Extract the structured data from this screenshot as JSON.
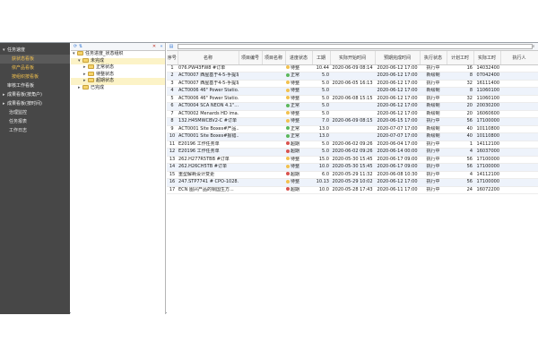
{
  "nav": {
    "groups": [
      {
        "label": "任务速度",
        "children": [
          "获状态看板",
          "依产品看板",
          "按组织按看板"
        ]
      },
      {
        "label": "审核工作看板",
        "children": []
      },
      {
        "label": "成果看板(按角户)",
        "children": []
      },
      {
        "label": "成果看板(按时间)",
        "children": []
      }
    ],
    "plain": [
      "治理监控",
      "任务报表",
      "工作日志"
    ]
  },
  "tree": {
    "root": "任务进度_状态组织",
    "nodes": [
      {
        "label": "未完成",
        "level": 1,
        "expanded": true,
        "selected": true
      },
      {
        "label": "正常状态",
        "level": 2
      },
      {
        "label": "待整状态",
        "level": 2
      },
      {
        "label": "超期状态",
        "level": 2
      },
      {
        "label": "已完成",
        "level": 1
      }
    ]
  },
  "grid": {
    "columns": [
      "序号",
      "名称",
      "项目编号",
      "项目名称",
      "进度状态",
      "工期",
      "实际开始时间",
      "预期完成时间",
      "执行状态",
      "计划工时",
      "实际工时",
      "执行人"
    ],
    "rows": [
      {
        "no": "1",
        "name": "076.PW43FW8 #订单",
        "status": "待整",
        "status_color": "#f2c14e",
        "dur": "10.44",
        "start": "2020-06-09 08:14",
        "due": "2020-06-12 17:00",
        "exec": "执行中",
        "plan": "16",
        "actual": "14032400"
      },
      {
        "no": "2",
        "name": "ACT0007 西屋基于4-5-手提车...",
        "status": "正常",
        "status_color": "#5cb85c",
        "dur": "5.0",
        "start": "",
        "due": "2020-06-12 17:00",
        "exec": "新绘制",
        "plan": "8",
        "actual": "07042400"
      },
      {
        "no": "3",
        "name": "ACT0007 西屋基于4-5-手提车...",
        "status": "待整",
        "status_color": "#f2c14e",
        "dur": "5.0",
        "start": "2020-06-05 16:13",
        "due": "2020-06-12 17:00",
        "exec": "执行中",
        "plan": "32",
        "actual": "16111400"
      },
      {
        "no": "4",
        "name": "ACT0006 46\" Power Statio...",
        "status": "待整",
        "status_color": "#f2c14e",
        "dur": "5.0",
        "start": "",
        "due": "2020-06-12 17:00",
        "exec": "新绘制",
        "plan": "8",
        "actual": "11060100"
      },
      {
        "no": "5",
        "name": "ACT0006 46\" Power Statio...",
        "status": "待整",
        "status_color": "#f2c14e",
        "dur": "5.0",
        "start": "2020-06-08 15:15",
        "due": "2020-06-12 17:00",
        "exec": "执行中",
        "plan": "32",
        "actual": "11060100"
      },
      {
        "no": "6",
        "name": "ACT0004 SCA NEON 4.1\"...",
        "status": "正常",
        "status_color": "#5cb85c",
        "dur": "5.0",
        "start": "",
        "due": "2020-06-12 17:00",
        "exec": "新绘制",
        "plan": "20",
        "actual": "20030200"
      },
      {
        "no": "7",
        "name": "ACT0002 Menards HD ima...",
        "status": "待整",
        "status_color": "#f2c14e",
        "dur": "5.0",
        "start": "",
        "due": "2020-06-12 17:00",
        "exec": "新绘制",
        "plan": "20",
        "actual": "16060600"
      },
      {
        "no": "8",
        "name": "132.H45MWCBV2-C #订单",
        "status": "待整",
        "status_color": "#f2c14e",
        "dur": "7.0",
        "start": "2020-06-09 08:15",
        "due": "2020-06-15 17:00",
        "exec": "执行中",
        "plan": "56",
        "actual": "17100000"
      },
      {
        "no": "9",
        "name": "ACT0001 Site Boxes#产品...",
        "status": "正常",
        "status_color": "#5cb85c",
        "dur": "13.0",
        "start": "",
        "due": "2020-07-07 17:00",
        "exec": "新绘制",
        "plan": "40",
        "actual": "10110800"
      },
      {
        "no": "10",
        "name": "ACT0001 Site Boxes#报错...",
        "status": "正常",
        "status_color": "#5cb85c",
        "dur": "13.0",
        "start": "",
        "due": "2020-07-07 17:00",
        "exec": "新绘制",
        "plan": "40",
        "actual": "10110800"
      },
      {
        "no": "11",
        "name": "E20196 工作任务单",
        "status": "超期",
        "status_color": "#d9534f",
        "dur": "5.0",
        "start": "2020-06-02 09:26",
        "due": "2020-06-04 17:00",
        "exec": "执行中",
        "plan": "1",
        "actual": "14112100"
      },
      {
        "no": "12",
        "name": "E20196 工作任务单",
        "status": "超期",
        "status_color": "#d9534f",
        "dur": "5.0",
        "start": "2020-06-02 09:26",
        "due": "2020-06-14 00:00",
        "exec": "执行中",
        "plan": "4",
        "actual": "16037000"
      },
      {
        "no": "13",
        "name": "262.H277R5TBB #订单",
        "status": "待整",
        "status_color": "#f2c14e",
        "dur": "15.0",
        "start": "2020-05-30 15:45",
        "due": "2020-06-17 09:00",
        "exec": "执行中",
        "plan": "56",
        "actual": "17100000"
      },
      {
        "no": "14",
        "name": "262.H26CH5TB #订单",
        "status": "待整",
        "status_color": "#f2c14e",
        "dur": "10.0",
        "start": "2020-05-30 15:45",
        "due": "2020-06-17 09:00",
        "exec": "执行中",
        "plan": "56",
        "actual": "17100000"
      },
      {
        "no": "15",
        "name": "重型解耗设计变更",
        "status": "超期",
        "status_color": "#d9534f",
        "dur": "6.0",
        "start": "2020-05-29 11:32",
        "due": "2020-06-08 10:30",
        "exec": "执行中",
        "plan": "4",
        "actual": "14112100"
      },
      {
        "no": "16",
        "name": "247.STP7741 # CPO-1028...",
        "status": "待整",
        "status_color": "#f2c14e",
        "dur": "10.13",
        "start": "2020-05-29 10:02",
        "due": "2020-06-12 17:00",
        "exec": "执行中",
        "plan": "56",
        "actual": "17100000"
      },
      {
        "no": "17",
        "name": "ECN 图兴产品的铜国生方...",
        "status": "超期",
        "status_color": "#d9534f",
        "dur": "10.0",
        "start": "2020-05-28 17:43",
        "due": "2020-06-11 17:00",
        "exec": "执行中",
        "plan": "24",
        "actual": "16072200"
      }
    ]
  }
}
